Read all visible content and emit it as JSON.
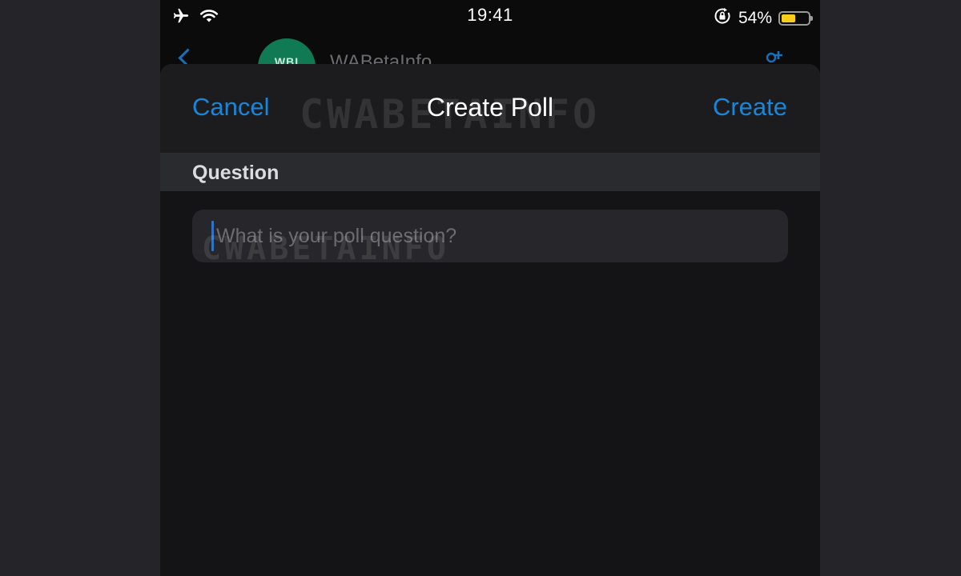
{
  "status_bar": {
    "time": "19:41",
    "battery_percent_label": "54%",
    "battery_level": 0.54,
    "battery_color": "#f7ce1b",
    "icons": [
      "airplane-mode-icon",
      "wifi-icon",
      "orientation-lock-icon",
      "battery-icon"
    ]
  },
  "background_chat": {
    "avatar_text": "WBI",
    "name_fragment": "WABetaInfo",
    "icons": [
      "back-chevron-icon",
      "add-participant-icon"
    ]
  },
  "sheet": {
    "nav": {
      "cancel_label": "Cancel",
      "title": "Create Poll",
      "create_label": "Create"
    },
    "section_header": "Question",
    "question_input": {
      "placeholder": "What is your poll question?",
      "value": ""
    }
  },
  "watermark": "CWABETAINFO",
  "colors": {
    "accent": "#1a86d8",
    "sheet_background": "#141417",
    "nav_background": "#1c1c1f",
    "section_background": "#2a2b2f",
    "field_background": "#27272b"
  }
}
